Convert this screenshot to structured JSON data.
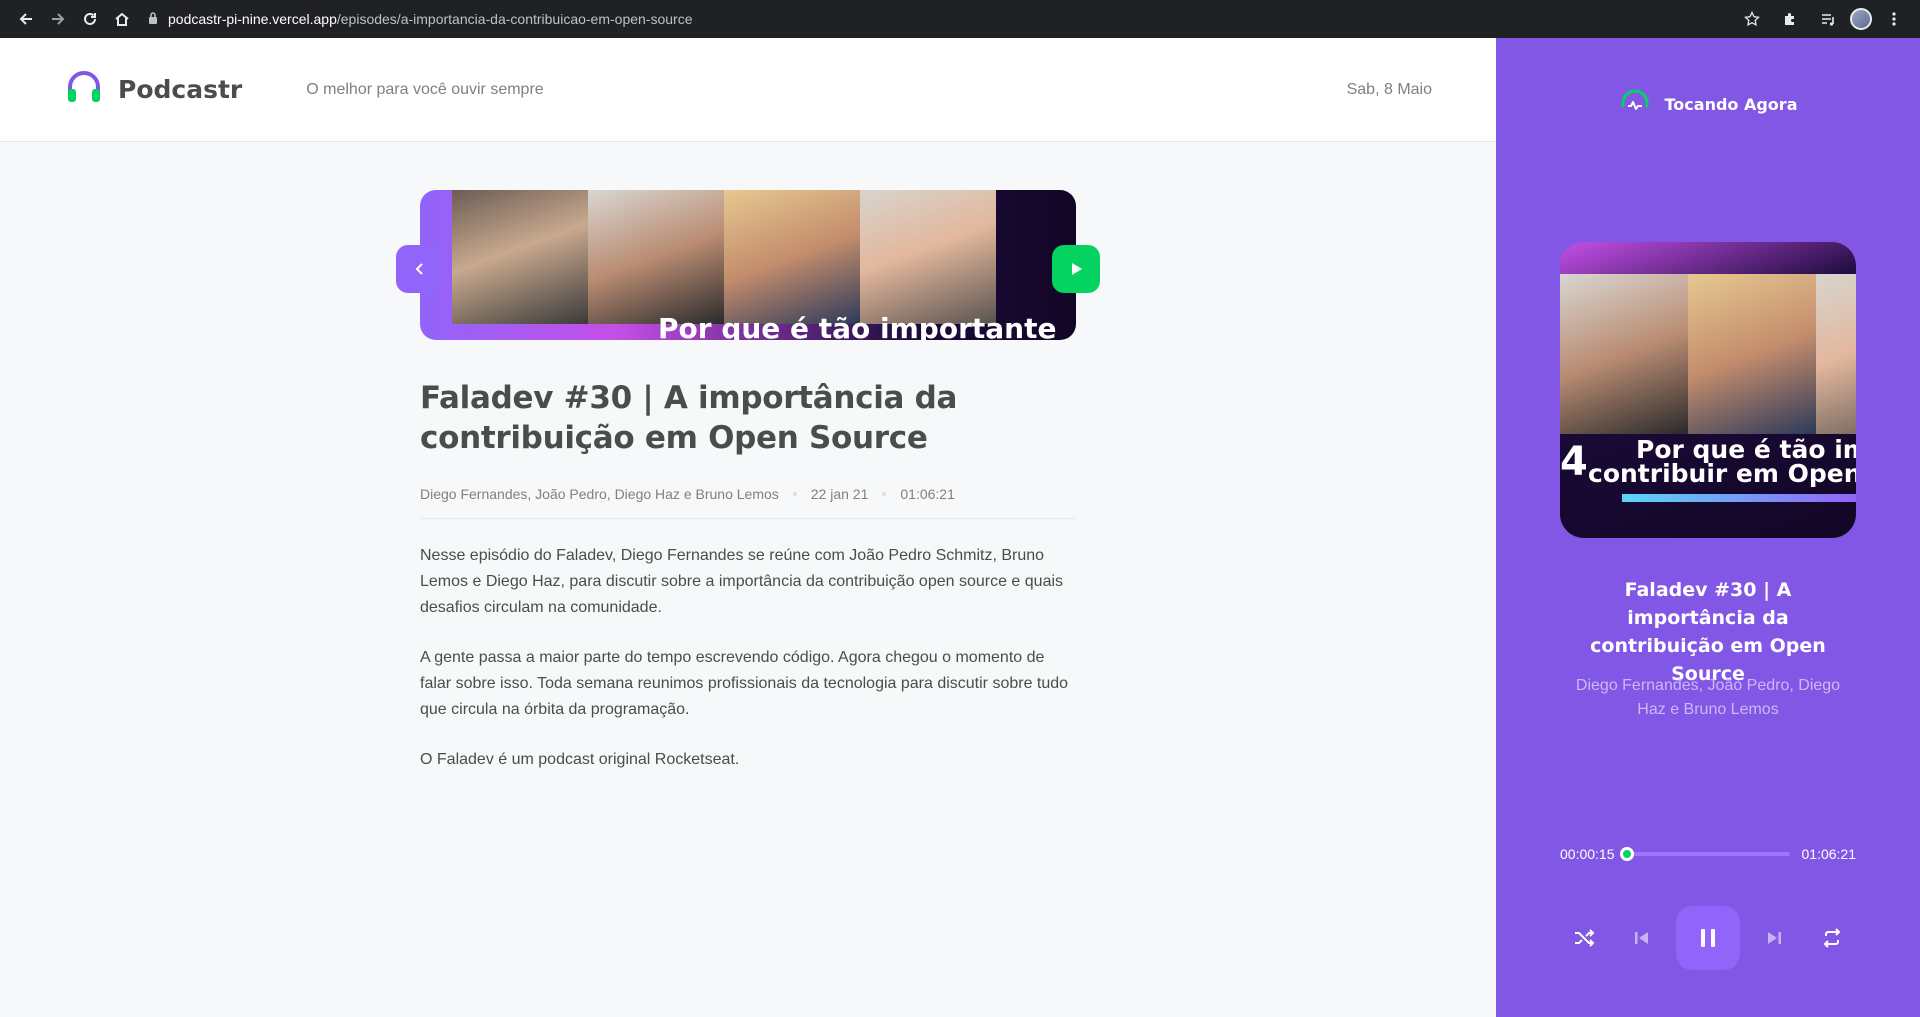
{
  "browser": {
    "url_host": "podcastr-pi-nine.vercel.app",
    "url_path": "/episodes/a-importancia-da-contribuicao-em-open-source"
  },
  "header": {
    "logo_text": "Podcastr",
    "tagline": "O melhor para você ouvir sempre",
    "date": "Sab, 8 Maio"
  },
  "episode": {
    "thumbnail_caption": "Por que é tão importante",
    "title": "Faladev #30 | A importância da contribuição em Open Source",
    "members": "Diego Fernandes, João Pedro, Diego Haz e Bruno Lemos",
    "published_at": "22 jan 21",
    "duration": "01:06:21",
    "description": [
      "Nesse episódio do Faladev, Diego Fernandes se reúne com João Pedro Schmitz, Bruno Lemos e Diego Haz, para discutir sobre a importância da contribuição open source e quais desafios circulam na comunidade.",
      "A gente passa a maior parte do tempo escrevendo código. Agora chegou o momento de falar sobre isso. Toda semana reunimos profissionais da tecnologia para discutir sobre tudo que circula na órbita da programação.",
      "O Faladev é um podcast original Rocketseat."
    ]
  },
  "player": {
    "heading": "Tocando Agora",
    "cover_caption_line1": "Por que é tão imp",
    "cover_caption_line2": "contribuir em Open S",
    "cover_number": "4",
    "title": "Faladev #30 | A importância da contribuição em Open Source",
    "members": "Diego Fernandes, João Pedro, Diego Haz e Bruno Lemos",
    "current_time": "00:00:15",
    "total_time": "01:06:21",
    "progress_fraction": 0.004
  },
  "colors": {
    "purple": "#8257e5",
    "purple_light": "#9164fa",
    "green": "#04d361"
  }
}
